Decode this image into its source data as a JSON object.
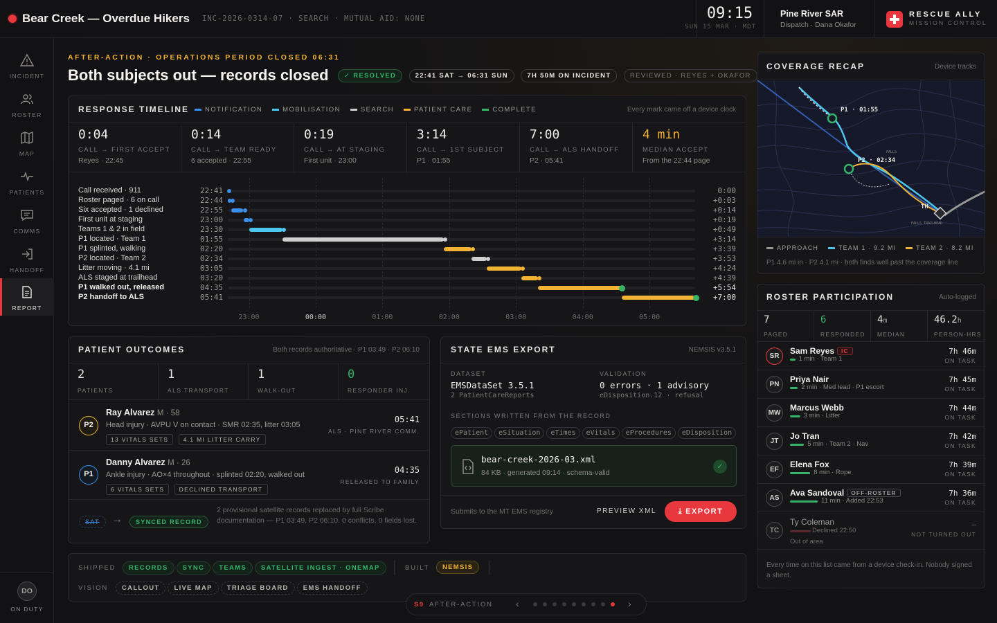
{
  "header": {
    "title": "Bear Creek — Overdue Hikers",
    "incident_id": "INC-2026-0314-07",
    "phase": "SEARCH",
    "mutual_aid": "MUTUAL AID: NONE",
    "clock": "09:15",
    "date": "SUN 15 MAR · MDT",
    "org_name": "Pine River SAR",
    "org_sub": "Dispatch · Dana Okafor",
    "brand_name": "RESCUE ALLY",
    "brand_sub": "MISSION CONTROL"
  },
  "nav": {
    "items": [
      {
        "label": "INCIDENT",
        "icon": "warning-icon"
      },
      {
        "label": "ROSTER",
        "icon": "people-icon"
      },
      {
        "label": "MAP",
        "icon": "map-icon"
      },
      {
        "label": "PATIENTS",
        "icon": "pulse-icon"
      },
      {
        "label": "COMMS",
        "icon": "chat-icon"
      },
      {
        "label": "HANDOFF",
        "icon": "handoff-icon"
      },
      {
        "label": "REPORT",
        "icon": "report-icon"
      }
    ],
    "active": "REPORT",
    "user_initials": "DO",
    "user_status": "ON DUTY"
  },
  "page": {
    "eyebrow": "AFTER-ACTION · OPERATIONS PERIOD CLOSED 06:31",
    "title": "Both subjects out — records closed",
    "status_chip": "RESOLVED",
    "range_chip": "22:41 SAT → 06:31 SUN",
    "duration_chip": "7H 50M ON INCIDENT",
    "reviewed_chip": "REVIEWED · REYES + OKAFOR"
  },
  "timeline": {
    "title": "RESPONSE TIMELINE",
    "legend": [
      {
        "label": "NOTIFICATION",
        "color": "#3b8fe8"
      },
      {
        "label": "MOBILISATION",
        "color": "#4cc6ef"
      },
      {
        "label": "SEARCH",
        "color": "#cfcfcf"
      },
      {
        "label": "PATIENT CARE",
        "color": "#f2b233"
      },
      {
        "label": "COMPLETE",
        "color": "#36b46a"
      }
    ],
    "note": "Every mark came off a device clock",
    "kpis": [
      {
        "value": "0:04",
        "label": "CALL → FIRST ACCEPT",
        "sub": "Reyes · 22:45"
      },
      {
        "value": "0:14",
        "label": "CALL → TEAM READY",
        "sub": "6 accepted · 22:55"
      },
      {
        "value": "0:19",
        "label": "CALL → AT STAGING",
        "sub": "First unit · 23:00"
      },
      {
        "value": "3:14",
        "label": "CALL → 1ST SUBJECT",
        "sub": "P1 · 01:55"
      },
      {
        "value": "7:00",
        "label": "CALL → ALS HANDOFF",
        "sub": "P2 · 05:41"
      },
      {
        "value": "4 min",
        "label": "MEDIAN ACCEPT",
        "sub": "From the 22:44 page"
      }
    ],
    "axis": [
      "23:00",
      "00:00",
      "01:00",
      "02:00",
      "03:00",
      "04:00",
      "05:00"
    ],
    "rows": [
      {
        "label": "Call received · 911",
        "time": "22:41",
        "offset": "0:00",
        "start": 0,
        "end": 0,
        "phase": "notification",
        "bold": false
      },
      {
        "label": "Roster paged · 6 on call",
        "time": "22:44",
        "offset": "+0:03",
        "start": 0,
        "end": 3,
        "phase": "notification",
        "bold": false
      },
      {
        "label": "Six accepted · 1 declined",
        "time": "22:55",
        "offset": "+0:14",
        "start": 3,
        "end": 14,
        "phase": "notification",
        "bold": false
      },
      {
        "label": "First unit at staging",
        "time": "23:00",
        "offset": "+0:19",
        "start": 14,
        "end": 19,
        "phase": "notification",
        "bold": false
      },
      {
        "label": "Teams 1 & 2 in field",
        "time": "23:30",
        "offset": "+0:49",
        "start": 19,
        "end": 49,
        "phase": "mobilisation",
        "bold": false
      },
      {
        "label": "P1 located · Team 1",
        "time": "01:55",
        "offset": "+3:14",
        "start": 49,
        "end": 194,
        "phase": "search",
        "bold": false
      },
      {
        "label": "P1 splinted, walking",
        "time": "02:20",
        "offset": "+3:39",
        "start": 194,
        "end": 219,
        "phase": "care",
        "bold": false
      },
      {
        "label": "P2 located · Team 2",
        "time": "02:34",
        "offset": "+3:53",
        "start": 219,
        "end": 233,
        "phase": "search",
        "bold": false
      },
      {
        "label": "Litter moving · 4.1 mi",
        "time": "03:05",
        "offset": "+4:24",
        "start": 233,
        "end": 264,
        "phase": "care",
        "bold": false
      },
      {
        "label": "ALS staged at trailhead",
        "time": "03:20",
        "offset": "+4:39",
        "start": 264,
        "end": 279,
        "phase": "care",
        "bold": false
      },
      {
        "label": "P1 walked out, released",
        "time": "04:35",
        "offset": "+5:54",
        "start": 279,
        "end": 354,
        "phase": "care-complete",
        "bold": true
      },
      {
        "label": "P2 handoff to ALS",
        "time": "05:41",
        "offset": "+7:00",
        "start": 354,
        "end": 420,
        "phase": "care-complete",
        "bold": true
      }
    ]
  },
  "coverage": {
    "title": "COVERAGE RECAP",
    "note": "Device tracks",
    "map_labels": {
      "p1": "P1 · 01:55",
      "p2": "P2 · 02:34",
      "th": "TH",
      "falls": "FALLS",
      "trailhead": "FALLS TRAILHEAD"
    },
    "legend": [
      {
        "label": "APPROACH",
        "color": "#9a9894"
      },
      {
        "label": "TEAM 1 · 9.2 MI",
        "color": "#4cc6ef"
      },
      {
        "label": "TEAM 2 · 8.2 MI",
        "color": "#f2b233"
      }
    ],
    "footnote": "P1 4.6 mi in · P2 4.1 mi · both finds well past the coverage line"
  },
  "roster": {
    "title": "ROSTER PARTICIPATION",
    "note": "Auto-logged",
    "stats": [
      {
        "value": "7",
        "unit": "",
        "label": "PAGED",
        "color": "#e8e6e3"
      },
      {
        "value": "6",
        "unit": "",
        "label": "RESPONDED",
        "color": "#36b46a"
      },
      {
        "value": "4",
        "unit": "m",
        "label": "MEDIAN",
        "color": "#e8e6e3"
      },
      {
        "value": "46.2",
        "unit": "h",
        "label": "PERSON-HRS",
        "color": "#e8e6e3"
      }
    ],
    "members": [
      {
        "initials": "SR",
        "name": "Sam Reyes",
        "tag": "IC",
        "tag_style": "ic",
        "accept": "1 min",
        "detail": "Team 1",
        "hours": "7h 46m",
        "status": "ON TASK",
        "bar": 0.1,
        "bar_color": "#36b46a"
      },
      {
        "initials": "PN",
        "name": "Priya Nair",
        "tag": "",
        "tag_style": "",
        "accept": "2 min",
        "detail": "Med lead · P1 escort",
        "hours": "7h 45m",
        "status": "ON TASK",
        "bar": 0.2,
        "bar_color": "#36b46a"
      },
      {
        "initials": "MW",
        "name": "Marcus Webb",
        "tag": "",
        "tag_style": "",
        "accept": "3 min",
        "detail": "Litter",
        "hours": "7h 44m",
        "status": "ON TASK",
        "bar": 0.3,
        "bar_color": "#36b46a"
      },
      {
        "initials": "JT",
        "name": "Jo Tran",
        "tag": "",
        "tag_style": "",
        "accept": "5 min",
        "detail": "Team 2 · Nav",
        "hours": "7h 42m",
        "status": "ON TASK",
        "bar": 0.45,
        "bar_color": "#36b46a"
      },
      {
        "initials": "EF",
        "name": "Elena Fox",
        "tag": "",
        "tag_style": "",
        "accept": "8 min",
        "detail": "Rope",
        "hours": "7h 39m",
        "status": "ON TASK",
        "bar": 0.7,
        "bar_color": "#36b46a"
      },
      {
        "initials": "AS",
        "name": "Ava Sandoval",
        "tag": "OFF-ROSTER",
        "tag_style": "off",
        "accept": "11 min",
        "detail": "Added 22:53",
        "hours": "7h 36m",
        "status": "ON TASK",
        "bar": 1.0,
        "bar_color": "#36b46a"
      }
    ],
    "declined": {
      "initials": "TC",
      "name": "Ty Coleman",
      "line1": "Declined 22:50",
      "line2": "Out of area",
      "hours": "—",
      "status": "NOT TURNED OUT"
    },
    "footnote": "Every time on this list came from a device check-in. Nobody signed a sheet."
  },
  "outcomes": {
    "title": "PATIENT OUTCOMES",
    "note": "Both records authoritative · P1 03:49 · P2 06:10",
    "stats": [
      {
        "value": "2",
        "label": "PATIENTS",
        "color": "#e8e6e3"
      },
      {
        "value": "1",
        "label": "ALS TRANSPORT",
        "color": "#e8e6e3"
      },
      {
        "value": "1",
        "label": "WALK-OUT",
        "color": "#e8e6e3"
      },
      {
        "value": "0",
        "label": "RESPONDER INJ.",
        "color": "#36b46a"
      }
    ],
    "patients": [
      {
        "badge": "P2",
        "name": "Ray Alvarez",
        "demo": "M · 58",
        "summary": "Head injury · AVPU V on contact · SMR 02:35, litter 03:05",
        "chips": [
          "13 VITALS SETS",
          "4.1 MI LITTER CARRY"
        ],
        "time": "05:41",
        "disposition": "ALS · PINE RIVER COMM."
      },
      {
        "badge": "P1",
        "name": "Danny Alvarez",
        "demo": "M · 26",
        "summary": "Ankle injury · AO×4 throughout · splinted 02:20, walked out",
        "chips": [
          "6 VITALS SETS",
          "DECLINED TRANSPORT"
        ],
        "time": "04:35",
        "disposition": "RELEASED TO FAMILY"
      }
    ],
    "sync": {
      "from": "SAT",
      "to": "SYNCED RECORD",
      "text": "2 provisional satellite records replaced by full Scribe documentation — P1 03:49, P2 06:10. 0 conflicts, 0 fields lost."
    }
  },
  "export": {
    "title": "STATE EMS EXPORT",
    "version": "NEMSIS v3.5.1",
    "dataset_label": "DATASET",
    "dataset_value": "EMSDataSet 3.5.1",
    "dataset_sub": "2 PatientCareReports",
    "validation_label": "VALIDATION",
    "validation_value": "0 errors · 1 advisory",
    "validation_sub": "eDisposition.12 · refusal",
    "sections_label": "SECTIONS WRITTEN FROM THE RECORD",
    "sections": [
      "ePatient",
      "eSituation",
      "eTimes",
      "eVitals",
      "eProcedures",
      "eDisposition"
    ],
    "file_name": "bear-creek-2026-03.xml",
    "file_meta": "84 KB · generated 09:14 · schema-valid",
    "footer_note": "Submits to the MT EMS registry",
    "preview_label": "PREVIEW XML",
    "export_label": "EXPORT"
  },
  "shipped": {
    "shipped_label": "SHIPPED",
    "shipped": [
      "RECORDS",
      "SYNC",
      "TEAMS",
      "SATELLITE INGEST · ONEMAP"
    ],
    "built_label": "BUILT",
    "built": [
      "NEMSIS"
    ],
    "vision_label": "VISION",
    "vision": [
      "CALLOUT",
      "LIVE MAP",
      "TRIAGE BOARD",
      "EMS HANDOFF"
    ]
  },
  "pager": {
    "step": "S9",
    "label": "AFTER-ACTION",
    "total": 9,
    "current": 9
  },
  "colors": {
    "accent": "#f2b233",
    "green": "#36b46a",
    "red": "#e8383d",
    "blue": "#3b8fe8",
    "cyan": "#4cc6ef"
  }
}
